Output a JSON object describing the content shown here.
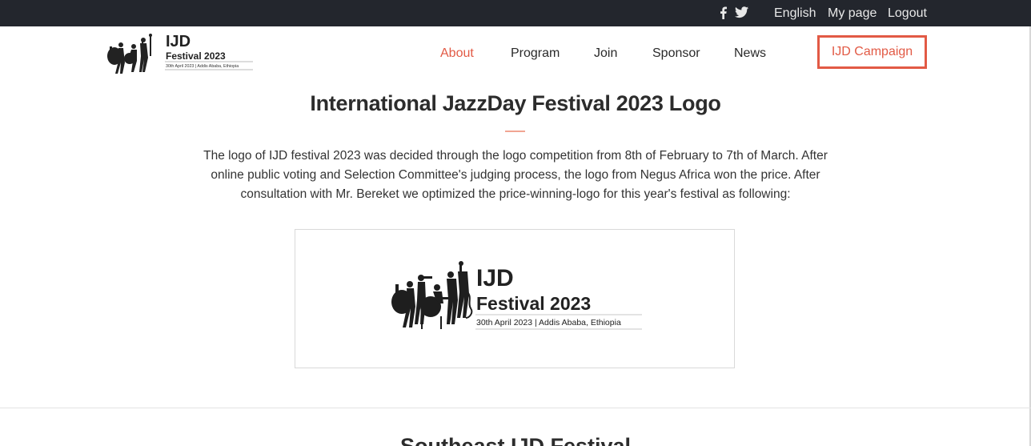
{
  "topbar": {
    "social_icons": [
      "facebook-icon",
      "twitter-icon"
    ],
    "links": [
      "English",
      "My page",
      "Logout"
    ]
  },
  "logo": {
    "line1": "IJD",
    "line2": "Festival 2023",
    "line3": "30th April 2023 | Addis Ababa, Ethiopia"
  },
  "nav": {
    "items": [
      "About",
      "Program",
      "Join",
      "Sponsor",
      "News"
    ],
    "active": "About",
    "campaign": "IJD Campaign"
  },
  "main": {
    "title": "International JazzDay Festival 2023 Logo",
    "paragraph": "The logo of IJD festival 2023 was decided through the logo competition from 8th of February to 7th of March. After online public voting and Selection Committee's judging process, the logo from Negus Africa won the price. After consultation with Mr. Bereket we optimized the price-winning-logo for this year's festival as following:",
    "next_title": "Southeast IJD Festival"
  },
  "colors": {
    "accent": "#e25a45",
    "topbar": "#23262d",
    "text": "#2c2c2c"
  }
}
